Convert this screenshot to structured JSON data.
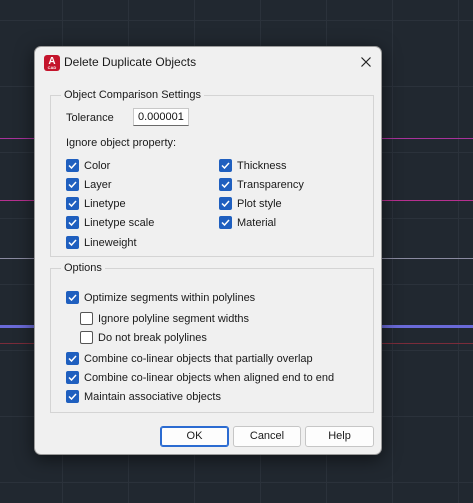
{
  "background": {
    "grid_color": "#2b323b",
    "lines": [
      {
        "color": "#a8329b"
      },
      {
        "color": "#b6308f"
      },
      {
        "color": "#8a8aa0"
      },
      {
        "color": "#6a6ad8"
      }
    ]
  },
  "dialog": {
    "title": "Delete Duplicate Objects",
    "app_icon_letter": "A",
    "app_icon_sub": "CAD",
    "comparison_group": {
      "label": "Object Comparison Settings",
      "tolerance_label": "Tolerance",
      "tolerance_value": "0.000001",
      "ignore_label": "Ignore object property:",
      "properties_left": [
        {
          "label": "Color",
          "checked": true
        },
        {
          "label": "Layer",
          "checked": true
        },
        {
          "label": "Linetype",
          "checked": true
        },
        {
          "label": "Linetype scale",
          "checked": true
        },
        {
          "label": "Lineweight",
          "checked": true
        }
      ],
      "properties_right": [
        {
          "label": "Thickness",
          "checked": true
        },
        {
          "label": "Transparency",
          "checked": true
        },
        {
          "label": "Plot style",
          "checked": true
        },
        {
          "label": "Material",
          "checked": true
        }
      ]
    },
    "options_group": {
      "label": "Options",
      "items": [
        {
          "label": "Optimize segments within polylines",
          "checked": true,
          "indent": false
        },
        {
          "label": "Ignore polyline segment widths",
          "checked": false,
          "indent": true
        },
        {
          "label": "Do not break polylines",
          "checked": false,
          "indent": true
        },
        {
          "label": "Combine co-linear objects that partially overlap",
          "checked": true,
          "indent": false
        },
        {
          "label": "Combine co-linear objects when aligned end to end",
          "checked": true,
          "indent": false
        },
        {
          "label": "Maintain associative objects",
          "checked": true,
          "indent": false
        }
      ]
    },
    "buttons": {
      "ok": "OK",
      "cancel": "Cancel",
      "help": "Help"
    },
    "accent_color": "#1f5fbf"
  }
}
